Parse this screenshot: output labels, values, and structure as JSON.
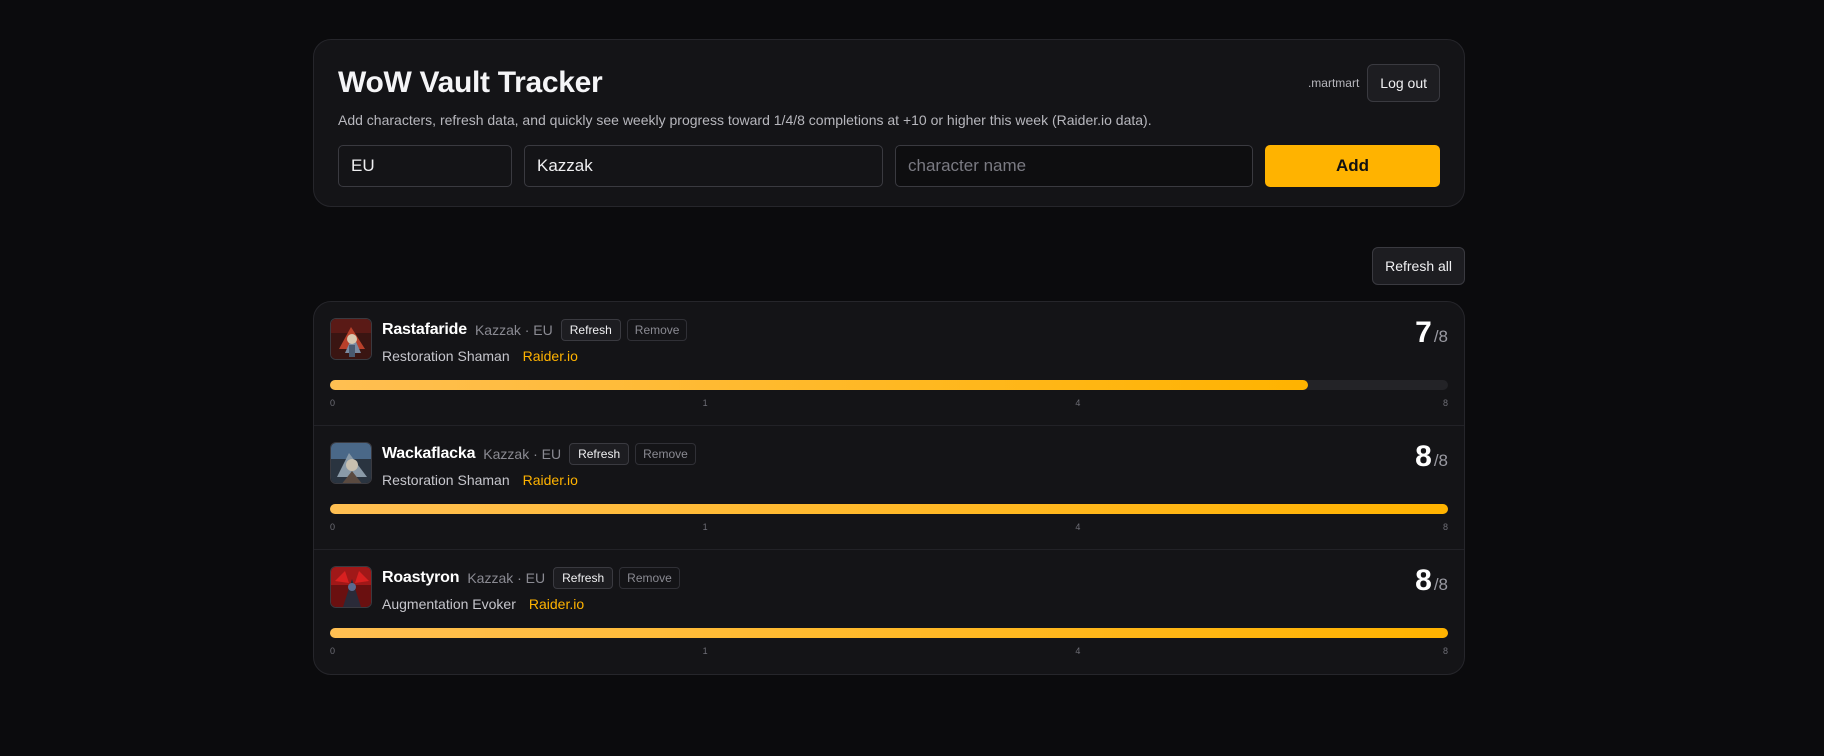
{
  "header": {
    "title": "WoW Vault Tracker",
    "subtitle": "Add characters, refresh data, and quickly see weekly progress toward 1/4/8 completions at +10 or higher this week (Raider.io data).",
    "username": ".martmart",
    "logout_label": "Log out"
  },
  "add_form": {
    "region_value": "EU",
    "realm_value": "Kazzak",
    "name_placeholder": "character name",
    "add_label": "Add"
  },
  "toolbar": {
    "refresh_all_label": "Refresh all"
  },
  "colors": {
    "accent": "#ffb300",
    "background": "#0b0b0d",
    "card": "#141417"
  },
  "tick_labels": [
    "0",
    "1",
    "4",
    "8"
  ],
  "characters": [
    {
      "name": "Rastafaride",
      "realm": "Kazzak · EU",
      "refresh_label": "Refresh",
      "remove_label": "Remove",
      "spec": "Restoration Shaman",
      "link_label": "Raider.io",
      "score": "7",
      "total": "/8",
      "progress": 0.875,
      "avatar_icon": "shaman-avatar-icon"
    },
    {
      "name": "Wackaflacka",
      "realm": "Kazzak · EU",
      "refresh_label": "Refresh",
      "remove_label": "Remove",
      "spec": "Restoration Shaman",
      "link_label": "Raider.io",
      "score": "8",
      "total": "/8",
      "progress": 1.0,
      "avatar_icon": "shaman-avatar-icon"
    },
    {
      "name": "Roastyron",
      "realm": "Kazzak · EU",
      "refresh_label": "Refresh",
      "remove_label": "Remove",
      "spec": "Augmentation Evoker",
      "link_label": "Raider.io",
      "score": "8",
      "total": "/8",
      "progress": 1.0,
      "avatar_icon": "evoker-avatar-icon"
    }
  ]
}
